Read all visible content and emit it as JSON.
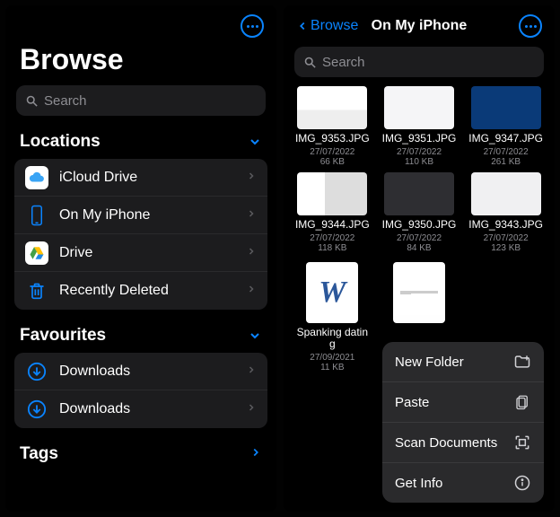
{
  "left": {
    "title": "Browse",
    "search_placeholder": "Search",
    "sections": {
      "locations": {
        "label": "Locations",
        "items": [
          {
            "label": "iCloud Drive"
          },
          {
            "label": "On My iPhone"
          },
          {
            "label": "Drive"
          },
          {
            "label": "Recently Deleted"
          }
        ]
      },
      "favourites": {
        "label": "Favourites",
        "items": [
          {
            "label": "Downloads"
          },
          {
            "label": "Downloads"
          }
        ]
      },
      "tags": {
        "label": "Tags"
      }
    }
  },
  "right": {
    "back_label": "Browse",
    "title": "On My iPhone",
    "search_placeholder": "Search",
    "files": [
      {
        "name": "IMG_9353.JPG",
        "date": "27/07/2022",
        "size": "66 KB"
      },
      {
        "name": "IMG_9351.JPG",
        "date": "27/07/2022",
        "size": "110 KB"
      },
      {
        "name": "IMG_9347.JPG",
        "date": "27/07/2022",
        "size": "261 KB"
      },
      {
        "name": "IMG_9344.JPG",
        "date": "27/07/2022",
        "size": "118 KB"
      },
      {
        "name": "IMG_9350.JPG",
        "date": "27/07/2022",
        "size": "84 KB"
      },
      {
        "name": "IMG_9343.JPG",
        "date": "27/07/2022",
        "size": "123 KB"
      }
    ],
    "docs": [
      {
        "name": "Spanking dating",
        "date": "27/09/2021",
        "size": "11 KB"
      }
    ],
    "menu": [
      {
        "label": "New Folder"
      },
      {
        "label": "Paste"
      },
      {
        "label": "Scan Documents"
      },
      {
        "label": "Get Info"
      }
    ]
  }
}
